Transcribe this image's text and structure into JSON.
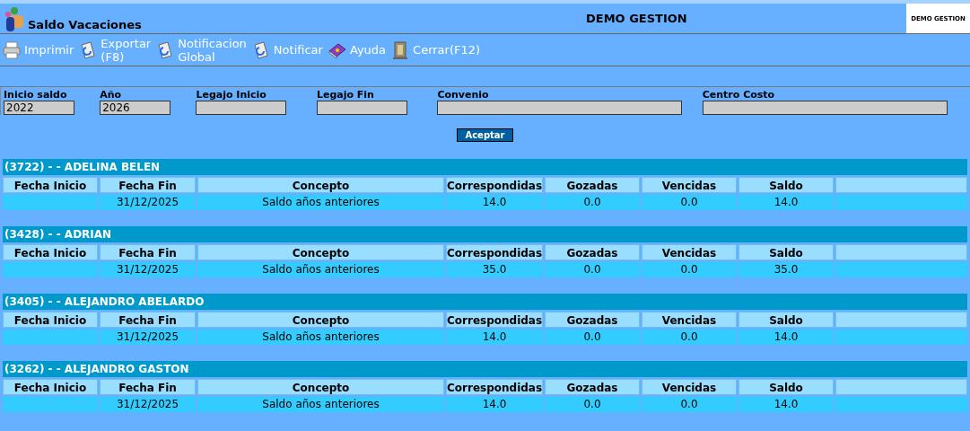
{
  "window": {
    "title": "Saldo Vacaciones",
    "company": "DEMO GESTION",
    "logo_text": "DEMO GESTION"
  },
  "toolbar": [
    {
      "label": "Imprimir",
      "kind": "print"
    },
    {
      "label": "Exportar\n(F8)",
      "kind": "export"
    },
    {
      "label": "Notificacion\nGlobal",
      "kind": "export"
    },
    {
      "label": "Notificar",
      "kind": "export"
    },
    {
      "label": "Ayuda",
      "kind": "help"
    },
    {
      "label": "Cerrar(F12)",
      "kind": "close"
    }
  ],
  "filters": [
    {
      "label": "Inicio saldo",
      "value": "2022"
    },
    {
      "label": "Año",
      "value": "2026"
    },
    {
      "label": "Legajo Inicio"
    },
    {
      "label": "Legajo Fin"
    },
    {
      "label": "Convenio"
    },
    {
      "label": "Centro Costo"
    }
  ],
  "accept_button": "Aceptar",
  "employees": [
    {
      "title": "(3722) - - ADELINA BELEN",
      "columns": [
        "Fecha Inicio",
        "Fecha Fin",
        "Concepto",
        "Correspondidas",
        "Gozadas",
        "Vencidas",
        "Saldo"
      ],
      "rows": [
        [
          "",
          "31/12/2025",
          "Saldo años anteriores",
          "14.0",
          "0.0",
          "0.0",
          "14.0"
        ]
      ]
    },
    {
      "title": "(3428) - - ADRIAN",
      "columns": [
        "Fecha Inicio",
        "Fecha Fin",
        "Concepto",
        "Correspondidas",
        "Gozadas",
        "Vencidas",
        "Saldo"
      ],
      "rows": [
        [
          "",
          "31/12/2025",
          "Saldo años anteriores",
          "35.0",
          "0.0",
          "0.0",
          "35.0"
        ]
      ]
    },
    {
      "title": "(3405) - - ALEJANDRO ABELARDO",
      "columns": [
        "Fecha Inicio",
        "Fecha Fin",
        "Concepto",
        "Correspondidas",
        "Gozadas",
        "Vencidas",
        "Saldo"
      ],
      "rows": [
        [
          "",
          "31/12/2025",
          "Saldo años anteriores",
          "14.0",
          "0.0",
          "0.0",
          "14.0"
        ]
      ]
    },
    {
      "title": "(3262) - - ALEJANDRO GASTON",
      "columns": [
        "Fecha Inicio",
        "Fecha Fin",
        "Concepto",
        "Correspondidas",
        "Gozadas",
        "Vencidas",
        "Saldo"
      ],
      "rows": [
        [
          "",
          "31/12/2025",
          "Saldo años anteriores",
          "14.0",
          "0.0",
          "0.0",
          "14.0"
        ]
      ]
    }
  ]
}
